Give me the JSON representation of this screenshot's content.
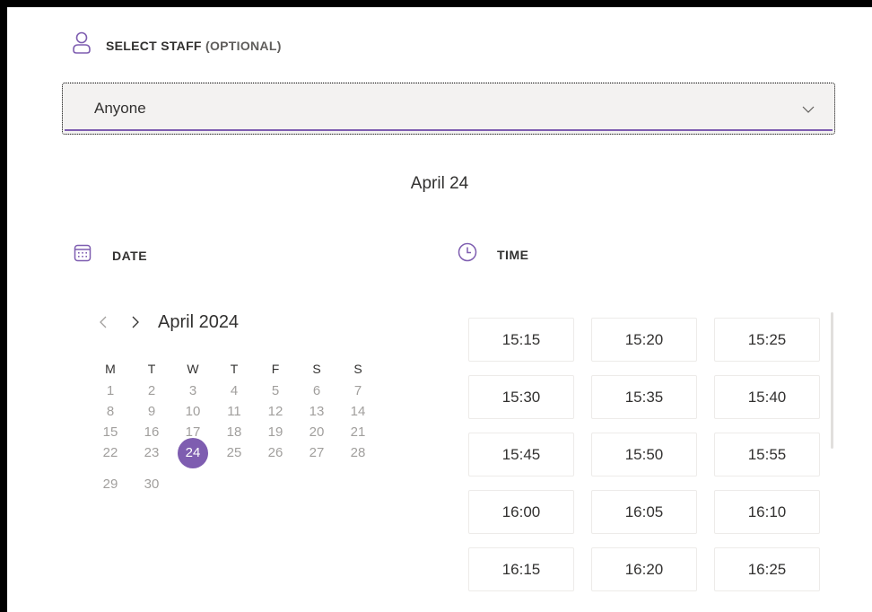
{
  "staff": {
    "label": "SELECT STAFF",
    "optional": "(OPTIONAL)",
    "selected_value": "Anyone",
    "icon": "person-icon"
  },
  "selected_date": "April 24",
  "date_section": {
    "label": "DATE",
    "icon": "calendar-icon"
  },
  "time_section": {
    "label": "TIME",
    "icon": "clock-icon"
  },
  "calendar": {
    "month_label": "April 2024",
    "weekdays": [
      "M",
      "T",
      "W",
      "T",
      "F",
      "S",
      "S"
    ],
    "weeks": [
      [
        "1",
        "2",
        "3",
        "4",
        "5",
        "6",
        "7"
      ],
      [
        "8",
        "9",
        "10",
        "11",
        "12",
        "13",
        "14"
      ],
      [
        "15",
        "16",
        "17",
        "18",
        "19",
        "20",
        "21"
      ],
      [
        "22",
        "23",
        "24",
        "25",
        "26",
        "27",
        "28"
      ],
      [
        "29",
        "30",
        "",
        "",
        "",
        "",
        ""
      ]
    ],
    "selected_day": "24"
  },
  "time_slots": [
    "15:15",
    "15:20",
    "15:25",
    "15:30",
    "15:35",
    "15:40",
    "15:45",
    "15:50",
    "15:55",
    "16:00",
    "16:05",
    "16:10",
    "16:15",
    "16:20",
    "16:25"
  ],
  "colors": {
    "accent": "#7e5db0",
    "text": "#323130",
    "muted": "#a19f9d",
    "field_bg": "#f3f2f1"
  }
}
